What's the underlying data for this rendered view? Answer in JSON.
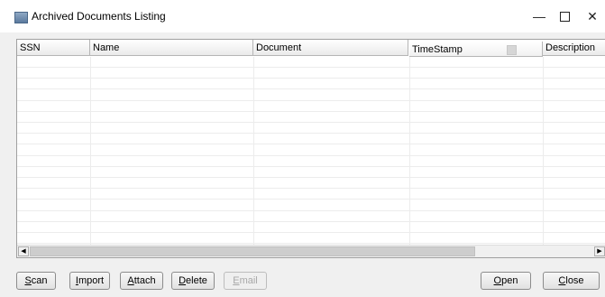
{
  "window": {
    "title": "Archived Documents Listing",
    "minimize_label": "—",
    "close_label": "✕"
  },
  "grid": {
    "columns": [
      "SSN",
      "Name",
      "Document",
      "TimeStamp",
      "Description"
    ],
    "sorted_column": "TimeStamp",
    "rows": []
  },
  "scrollbar": {
    "left_arrow": "◀",
    "right_arrow": "▶"
  },
  "buttons": {
    "scan": {
      "mnemonic": "S",
      "rest": "can"
    },
    "import": {
      "mnemonic": "I",
      "rest": "mport"
    },
    "attach": {
      "mnemonic": "A",
      "rest": "ttach"
    },
    "delete": {
      "mnemonic": "D",
      "rest": "elete"
    },
    "email": {
      "mnemonic": "E",
      "rest": "mail",
      "disabled": true
    },
    "open": {
      "mnemonic": "O",
      "rest": "pen"
    },
    "close": {
      "mnemonic": "C",
      "rest": "lose"
    }
  }
}
